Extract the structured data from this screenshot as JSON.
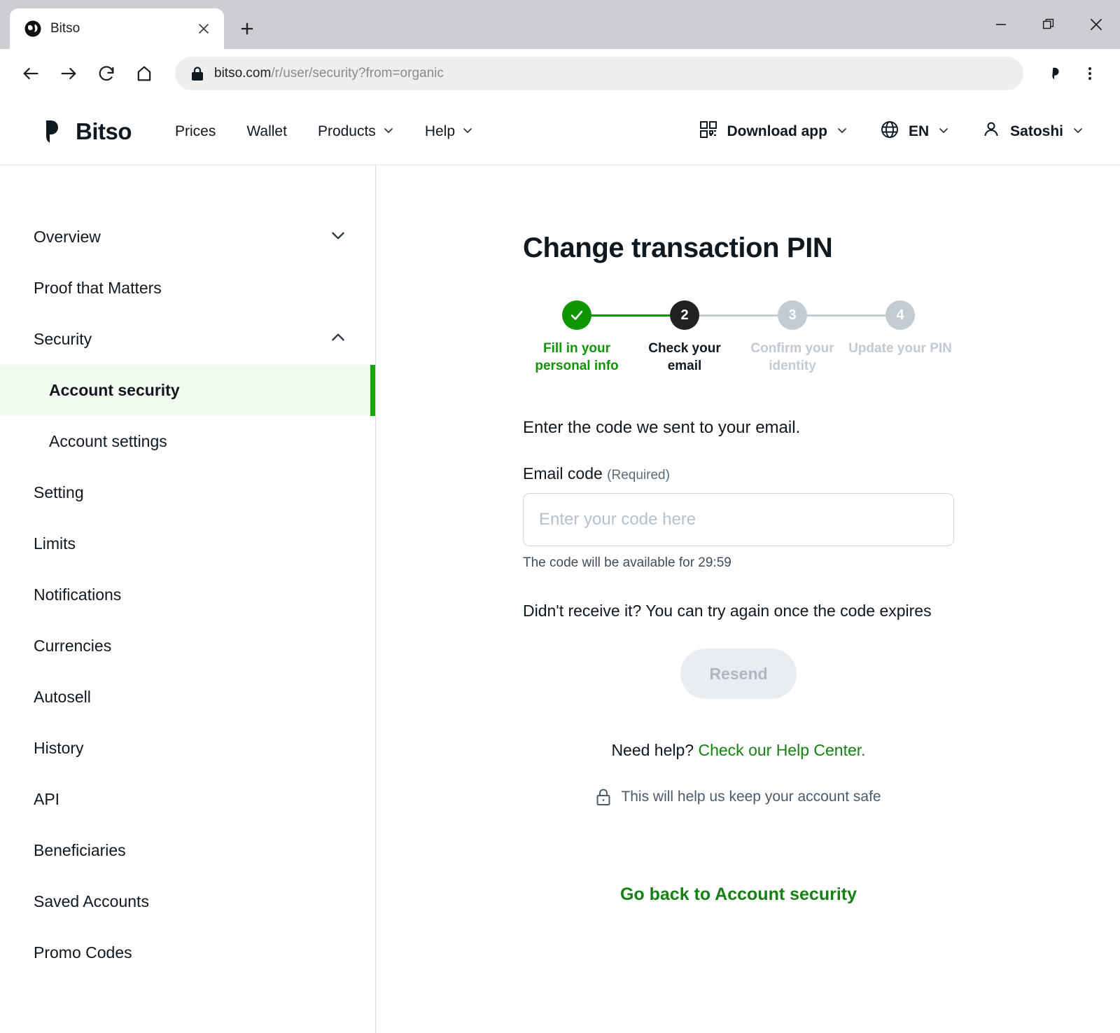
{
  "browser": {
    "tab": {
      "title": "Bitso",
      "favicon_icon": "globe-icon",
      "close_icon": "close-icon"
    },
    "new_tab_icon": "plus-icon",
    "window_controls": {
      "minimize_icon": "minimize-icon",
      "maximize_icon": "restore-icon",
      "close_icon": "close-icon"
    },
    "nav": {
      "back_icon": "arrow-left-icon",
      "forward_icon": "arrow-right-icon",
      "reload_icon": "reload-icon",
      "home_icon": "home-icon"
    },
    "omnibox": {
      "lock_icon": "padlock-icon",
      "url_domain": "bitso.com",
      "url_path": "/r/user/security?from=organic"
    },
    "toolbar_right": {
      "extension_icon": "bitso-extension-icon",
      "menu_icon": "three-dot-menu-icon"
    }
  },
  "site_nav": {
    "brand": "Bitso",
    "brand_icon": "bitso-logo-icon",
    "menu": [
      {
        "label": "Prices",
        "has_caret": false
      },
      {
        "label": "Wallet",
        "has_caret": false
      },
      {
        "label": "Products",
        "has_caret": true
      },
      {
        "label": "Help",
        "has_caret": true
      }
    ],
    "download_app": {
      "label": "Download app",
      "icon": "qr-code-icon",
      "caret_icon": "chevron-down-icon"
    },
    "language": {
      "label": "EN",
      "icon": "globe-icon",
      "caret_icon": "chevron-down-icon"
    },
    "account": {
      "label": "Satoshi",
      "icon": "user-icon",
      "caret_icon": "chevron-down-icon"
    }
  },
  "sidebar": {
    "items": [
      {
        "label": "Overview",
        "sub": false,
        "active": false,
        "chevron": "chevron-down-icon"
      },
      {
        "label": "Proof that Matters",
        "sub": false,
        "active": false,
        "chevron": ""
      },
      {
        "label": "Security",
        "sub": false,
        "active": false,
        "chevron": "chevron-up-icon"
      },
      {
        "label": "Account security",
        "sub": true,
        "active": true,
        "chevron": ""
      },
      {
        "label": "Account settings",
        "sub": true,
        "active": false,
        "chevron": ""
      },
      {
        "label": "Setting",
        "sub": false,
        "active": false,
        "chevron": ""
      },
      {
        "label": "Limits",
        "sub": false,
        "active": false,
        "chevron": ""
      },
      {
        "label": "Notifications",
        "sub": false,
        "active": false,
        "chevron": ""
      },
      {
        "label": "Currencies",
        "sub": false,
        "active": false,
        "chevron": ""
      },
      {
        "label": "Autosell",
        "sub": false,
        "active": false,
        "chevron": ""
      },
      {
        "label": "History",
        "sub": false,
        "active": false,
        "chevron": ""
      },
      {
        "label": "API",
        "sub": false,
        "active": false,
        "chevron": ""
      },
      {
        "label": "Beneficiaries",
        "sub": false,
        "active": false,
        "chevron": ""
      },
      {
        "label": "Saved Accounts",
        "sub": false,
        "active": false,
        "chevron": ""
      },
      {
        "label": "Promo Codes",
        "sub": false,
        "active": false,
        "chevron": ""
      }
    ]
  },
  "main": {
    "title": "Change transaction PIN",
    "steps": [
      {
        "marker": "check-icon",
        "label": "Fill in your personal info",
        "state": "done"
      },
      {
        "marker": "2",
        "label": "Check your email",
        "state": "current"
      },
      {
        "marker": "3",
        "label": "Confirm your identity",
        "state": "todo"
      },
      {
        "marker": "4",
        "label": "Update your PIN",
        "state": "todo"
      }
    ],
    "lead": "Enter the code we sent to your email.",
    "field_label": "Email code",
    "field_required": "(Required)",
    "input_value": "",
    "input_placeholder": "Enter your code here",
    "timer_hint": "The code will be available for 29:59",
    "retry_text": "Didn't receive it? You can try again once the code expires",
    "resend_label": "Resend",
    "resend_disabled": true,
    "need_help_prefix": "Need help? ",
    "need_help_link": "Check our Help Center.",
    "safe_note": "This will help us keep your account safe",
    "safe_note_icon": "padlock-icon",
    "go_back_label": "Go back to Account security"
  },
  "colors": {
    "brand_green": "#0e9500",
    "link_green": "#168014",
    "active_bg": "#f2fbf0",
    "active_bar": "#16a800",
    "step_current": "#212121",
    "step_todo": "#c2cad2",
    "ink": "#101820"
  }
}
